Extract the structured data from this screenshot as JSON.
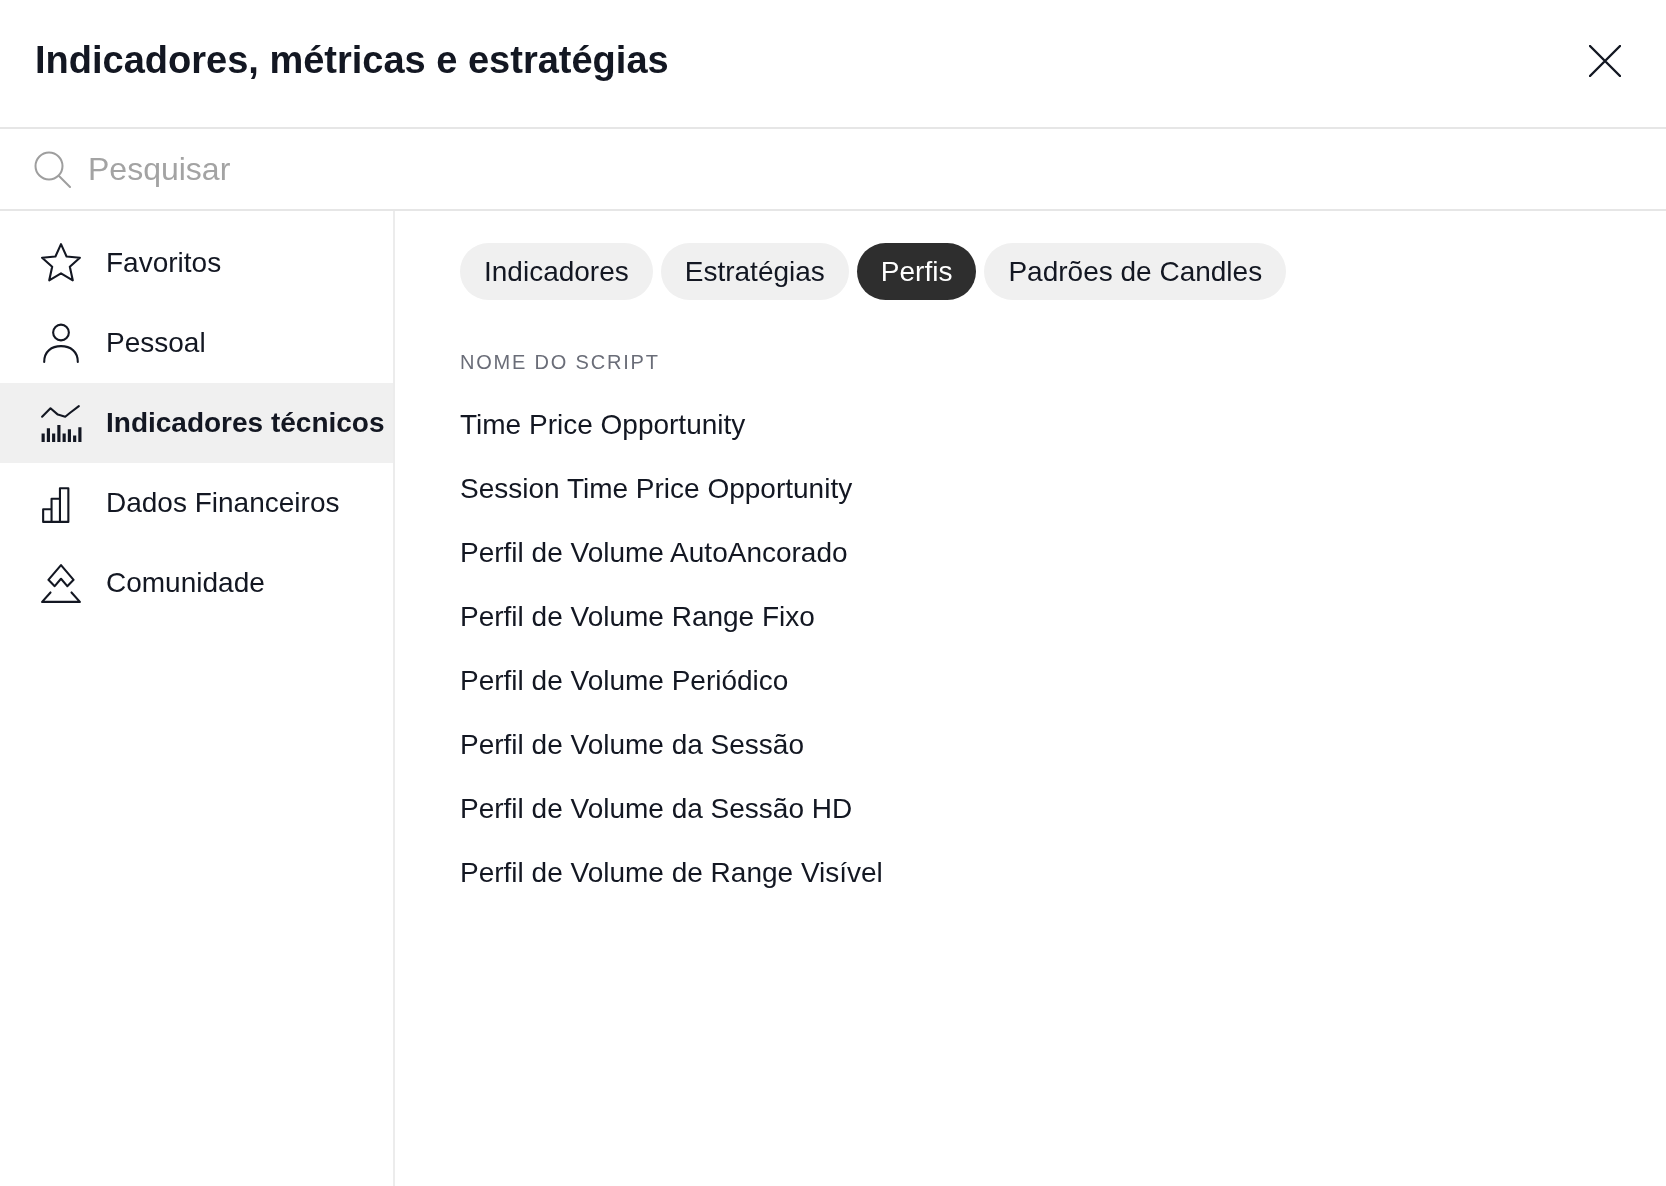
{
  "dialog": {
    "title": "Indicadores, métricas e estratégias"
  },
  "search": {
    "placeholder": "Pesquisar"
  },
  "sidebar": {
    "items": [
      {
        "label": "Favoritos",
        "selected": false
      },
      {
        "label": "Pessoal",
        "selected": false
      },
      {
        "label": "Indicadores técnicos",
        "selected": true
      },
      {
        "label": "Dados Financeiros",
        "selected": false
      },
      {
        "label": "Comunidade",
        "selected": false
      }
    ]
  },
  "tabs": [
    {
      "label": "Indicadores",
      "selected": false
    },
    {
      "label": "Estratégias",
      "selected": false
    },
    {
      "label": "Perfis",
      "selected": true
    },
    {
      "label": "Padrões de Candles",
      "selected": false
    }
  ],
  "script_list": {
    "header": "NOME DO SCRIPT",
    "items": [
      "Time Price Opportunity",
      "Session Time Price Opportunity",
      "Perfil de Volume AutoAncorado",
      "Perfil de Volume Range Fixo",
      "Perfil de Volume Periódico",
      "Perfil de Volume da Sessão",
      "Perfil de Volume da Sessão HD",
      "Perfil de Volume de Range Visível"
    ]
  }
}
